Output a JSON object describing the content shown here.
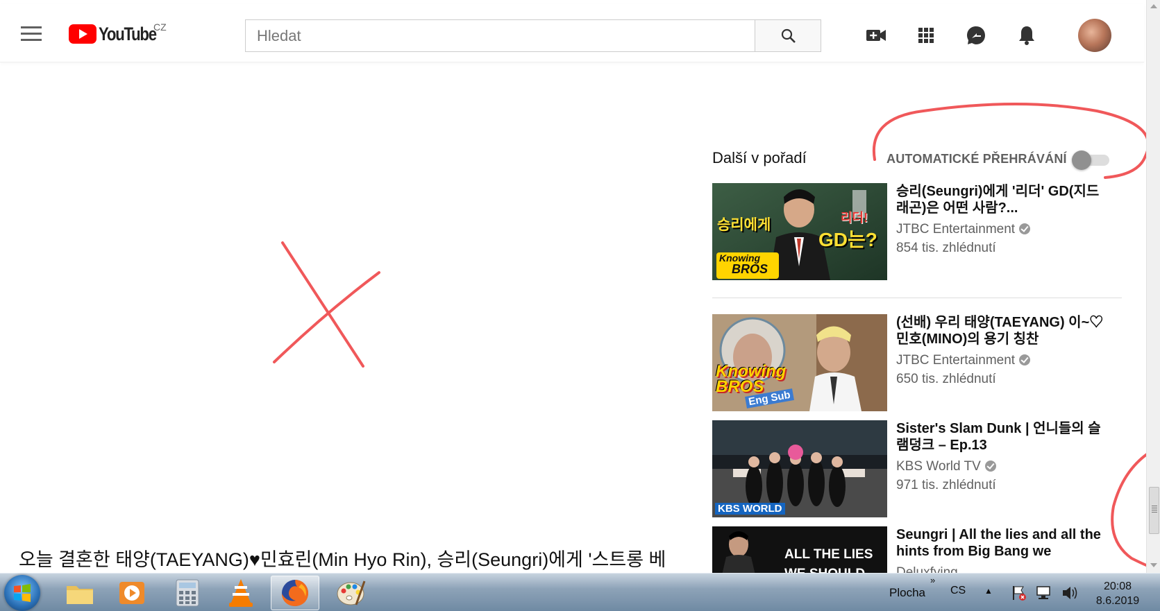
{
  "header": {
    "logo_text": "YouTube",
    "country": "CZ",
    "search_placeholder": "Hledat"
  },
  "up_next": {
    "title": "Další v pořadí",
    "autoplay_label": "AUTOMATICKÉ PŘEHRÁVÁNÍ",
    "autoplay_on": false
  },
  "videos": [
    {
      "title": "승리(Seungri)에게 '리더' GD(지드래곤)은 어떤 사람?...",
      "channel": "JTBC Entertainment",
      "views": "854 tis. zhlédnutí",
      "thumb_text_1": "승리에게",
      "thumb_text_2": "리더!",
      "thumb_text_3": "GD는?",
      "thumb_text_4": "Knowing",
      "thumb_text_5": "BROS"
    },
    {
      "title": "(선배) 우리 태양(TAEYANG) 이~♡ 민호(MINO)의 용기 칭찬",
      "channel": "JTBC Entertainment",
      "views": "650 tis. zhlédnutí",
      "thumb_text_1": "Knowing",
      "thumb_text_2": "BROS",
      "thumb_text_3": "Eng Sub"
    },
    {
      "title": "Sister's Slam Dunk | 언니들의 슬램덩크 – Ep.13",
      "channel": "KBS World TV",
      "views": "971 tis. zhlédnutí",
      "thumb_text_1": "KBS WORLD"
    },
    {
      "title": "Seungri | All the lies and all the hints from Big Bang we",
      "channel": "Deluxfying",
      "thumb_text_1": "ALL THE LIES",
      "thumb_text_2": "WE SHOULD"
    }
  ],
  "main": {
    "video_title": "오늘 결혼한 태양(TAEYANG)♥민효린(Min Hyo Rin), 승리(Seungri)에게 '스트롱 베"
  },
  "taskbar": {
    "desktop_label": "Plocha",
    "language": "CS",
    "time": "20:08",
    "date": "8.6.2019"
  },
  "colors": {
    "brand_red": "#ff0000",
    "annotation": "#f0585a"
  }
}
